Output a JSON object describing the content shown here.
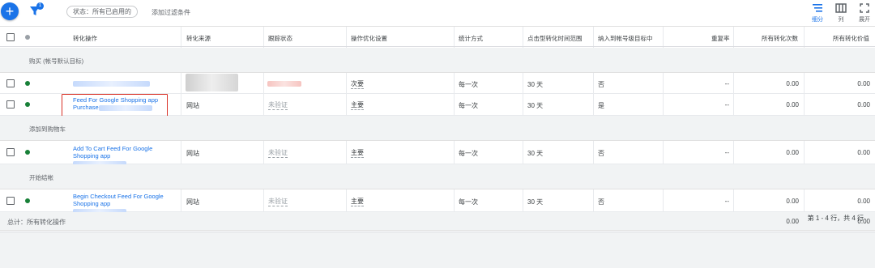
{
  "toolbar": {
    "add_button": "+",
    "filter_count": "1",
    "status_chip": "状态：所有已启用的",
    "add_filter": "添加过滤条件",
    "tools": [
      {
        "icon": "segment-icon",
        "label": "细分"
      },
      {
        "icon": "columns-icon",
        "label": "列"
      },
      {
        "icon": "expand-icon",
        "label": "展开"
      }
    ]
  },
  "columns": [
    "转化操作",
    "转化来源",
    "跟踪状态",
    "操作优化设置",
    "统计方式",
    "点击型转化时间范围",
    "纳入到帐号级目标中",
    "重复率",
    "所有转化次数",
    "所有转化价值"
  ],
  "sections": [
    {
      "label": "购买 (帐号默认目标)",
      "rows": [
        {
          "name": "",
          "source": "",
          "tracking": "",
          "optimization": "次要",
          "counting": "每一次",
          "window": "30 天",
          "included": "否",
          "repeat": "--",
          "conversions": "0.00",
          "value": "0.00"
        },
        {
          "name": "Feed For Google Shopping app Purchase",
          "source": "网站",
          "tracking": "未验证",
          "optimization": "主要",
          "counting": "每一次",
          "window": "30 天",
          "included": "是",
          "repeat": "--",
          "conversions": "0.00",
          "value": "0.00"
        }
      ]
    },
    {
      "label": "添加到购物车",
      "rows": [
        {
          "name": "Add To Cart Feed For Google Shopping app",
          "source": "网站",
          "tracking": "未验证",
          "optimization": "主要",
          "counting": "每一次",
          "window": "30 天",
          "included": "否",
          "repeat": "--",
          "conversions": "0.00",
          "value": "0.00"
        }
      ]
    },
    {
      "label": "开始结帐",
      "rows": [
        {
          "name": "Begin Checkout Feed For Google Shopping app",
          "source": "网站",
          "tracking": "未验证",
          "optimization": "主要",
          "counting": "每一次",
          "window": "30 天",
          "included": "否",
          "repeat": "--",
          "conversions": "0.00",
          "value": "0.00"
        }
      ]
    }
  ],
  "total": {
    "label": "总计：所有转化操作",
    "conversions": "0.00",
    "value": "0.00"
  },
  "pager": "第 1 - 4 行，共 4 行"
}
